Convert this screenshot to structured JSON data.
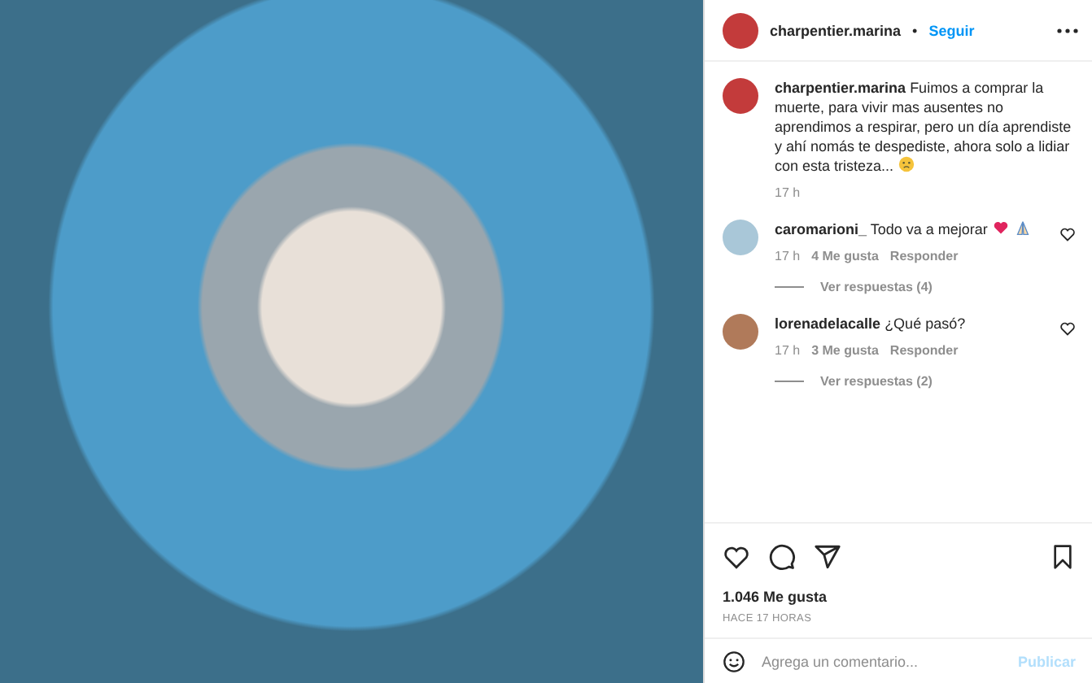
{
  "header": {
    "username": "charpentier.marina",
    "separator": "•",
    "follow": "Seguir"
  },
  "caption": {
    "username": "charpentier.marina",
    "text": "Fuimos a comprar la muerte, para vivir mas ausentes no aprendimos a respirar, pero un día aprendiste y ahí nomás te despediste, ahora solo a lidiar con esta tristeza...",
    "emojis": [
      {
        "kind": "sad"
      }
    ],
    "time": "17 h"
  },
  "comments": [
    {
      "username": "caromarioni_",
      "text": "Todo va a mejorar",
      "emojis": [
        {
          "kind": "heart"
        },
        {
          "kind": "hands"
        }
      ],
      "time": "17 h",
      "likes": "4 Me gusta",
      "reply": "Responder",
      "replies": "Ver respuestas (4)",
      "liked": false
    },
    {
      "username": "lorenadelacalle",
      "text": "¿Qué pasó?",
      "time": "17 h",
      "likes": "3 Me gusta",
      "reply": "Responder",
      "replies": "Ver respuestas (2)",
      "liked": false
    }
  ],
  "likes": "1.046 Me gusta",
  "timestamp": "HACE 17 HORAS",
  "add_comment": {
    "placeholder": "Agrega un comentario...",
    "post": "Publicar"
  }
}
